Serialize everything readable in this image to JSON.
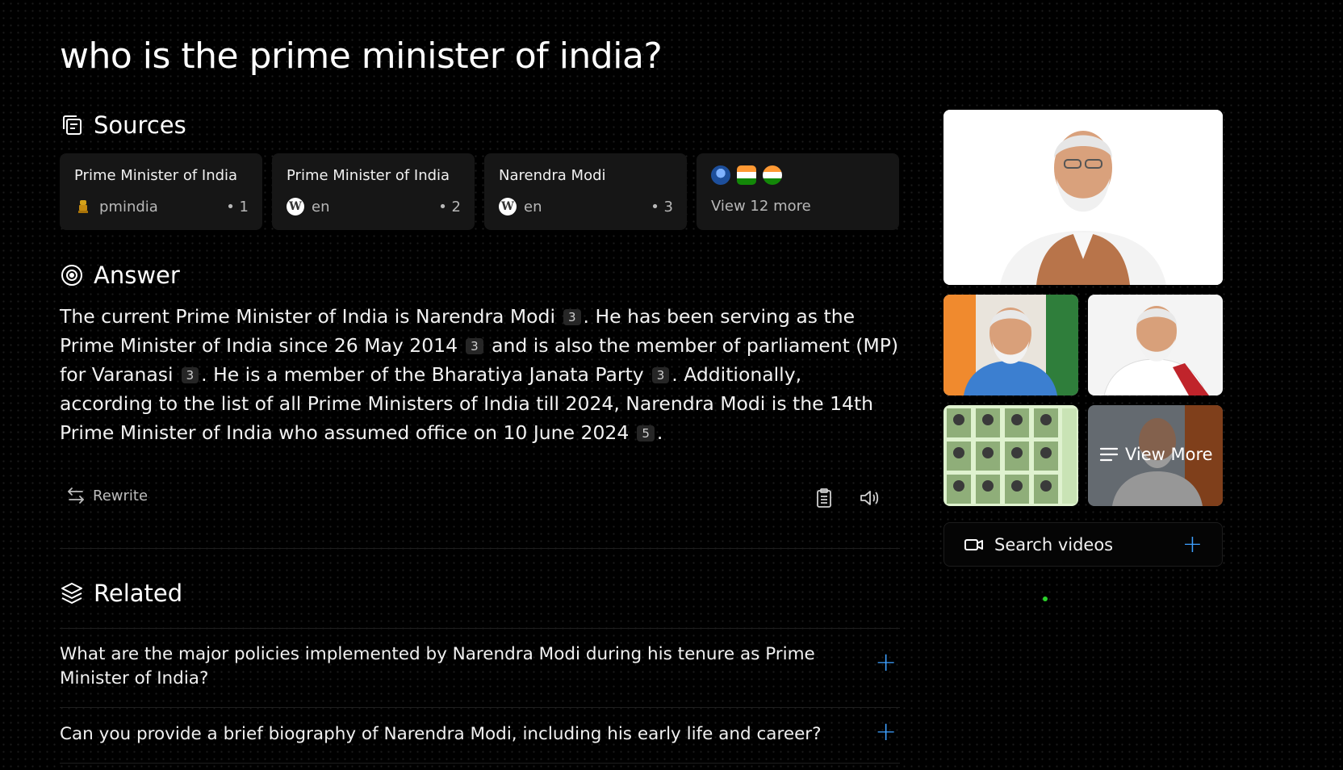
{
  "question": "who is the prime minister of india?",
  "sources": {
    "heading": "Sources",
    "cards": [
      {
        "title": "Prime Minister of India",
        "site": "pmindia",
        "index": "• 1",
        "icon": "pmindia-emblem-icon"
      },
      {
        "title": "Prime Minister of India",
        "site": "en",
        "index": "• 2",
        "icon": "wikipedia-icon"
      },
      {
        "title": "Narendra Modi",
        "site": "en",
        "index": "• 3",
        "icon": "wikipedia-icon"
      }
    ],
    "more_label": "View 12 more",
    "more_icons": [
      "globe-emblem-icon",
      "india-flag-badge-icon",
      "india-flag-icon"
    ]
  },
  "answer": {
    "heading": "Answer",
    "segments": [
      {
        "text": "The current Prime Minister of India is Narendra Modi",
        "cite": "3"
      },
      {
        "text": ". He has been serving as the Prime Minister of India since 26 May 2014",
        "cite": "3"
      },
      {
        "text": " and is also the member of parliament (MP) for Varanasi",
        "cite": "3"
      },
      {
        "text": ". He is a member of the Bharatiya Janata Party",
        "cite": "3"
      },
      {
        "text": ". Additionally, according to the list of all Prime Ministers of India till 2024, Narendra Modi is the 14th Prime Minister of India who assumed office on 10 June 2024",
        "cite": "5"
      },
      {
        "text": ".",
        "cite": null
      }
    ]
  },
  "actions": {
    "rewrite_label": "Rewrite"
  },
  "related": {
    "heading": "Related",
    "items": [
      "What are the major policies implemented by Narendra Modi during his tenure as Prime Minister of India?",
      "Can you provide a brief biography of Narendra Modi, including his early life and career?"
    ]
  },
  "media": {
    "view_more_label": "View More",
    "search_videos_label": "Search videos"
  },
  "colors": {
    "accent": "#3ea0ff",
    "card_bg": "#161616",
    "status_dot": "#2bd12b"
  }
}
